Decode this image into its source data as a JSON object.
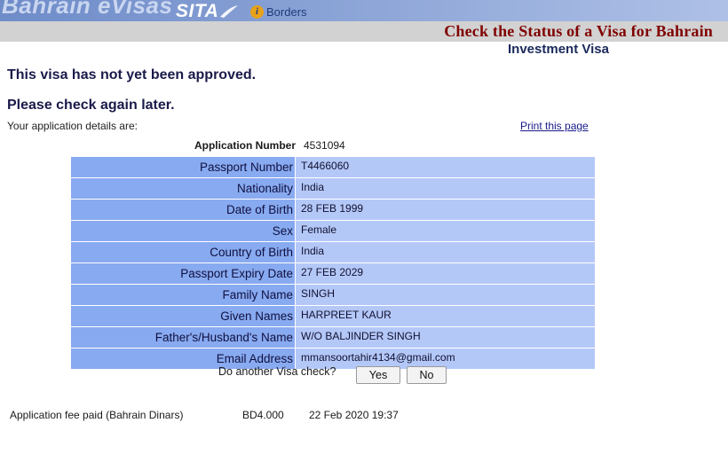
{
  "header": {
    "logo_text": "Bahrain eVisas",
    "sita_logo": "SITA",
    "borders_icon": "i",
    "borders_text": "Borders",
    "page_title": "Check the Status of a Visa for Bahrain",
    "visa_type": "Investment Visa"
  },
  "status": {
    "line1": "This visa has not yet been approved.",
    "line2": "Please check again later.",
    "details_intro": "Your application details are:",
    "print_link": "Print this page"
  },
  "application": {
    "number_label": "Application Number",
    "number_value": "4531094"
  },
  "details": [
    {
      "label": "Passport Number",
      "value": "T4466060"
    },
    {
      "label": "Nationality",
      "value": "India"
    },
    {
      "label": "Date of Birth",
      "value": "28 FEB 1999"
    },
    {
      "label": "Sex",
      "value": "Female"
    },
    {
      "label": "Country of Birth",
      "value": "India"
    },
    {
      "label": "Passport Expiry Date",
      "value": "27 FEB 2029"
    },
    {
      "label": "Family Name",
      "value": "SINGH"
    },
    {
      "label": "Given Names",
      "value": "HARPREET KAUR"
    },
    {
      "label": "Father's/Husband's Name",
      "value": "W/O BALJINDER SINGH"
    },
    {
      "label": "Email Address",
      "value": "mmansoortahir4134@gmail.com"
    }
  ],
  "another_check": {
    "question": "Do another Visa check?",
    "yes_label": "Yes",
    "no_label": "No"
  },
  "fee": {
    "label": "Application fee paid (Bahrain Dinars)",
    "amount": "BD4.000",
    "date": "22 Feb 2020 19:37"
  },
  "colors": {
    "label_bg": "#88aaf0",
    "value_bg": "#b4c8f8",
    "title_color": "#800000",
    "subbar_bg": "#d2d2d2"
  }
}
